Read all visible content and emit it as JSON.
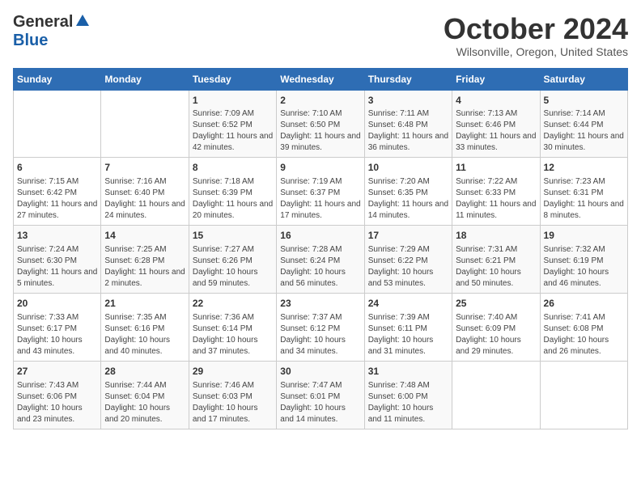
{
  "header": {
    "logo_general": "General",
    "logo_blue": "Blue",
    "title": "October 2024",
    "subtitle": "Wilsonville, Oregon, United States"
  },
  "days_of_week": [
    "Sunday",
    "Monday",
    "Tuesday",
    "Wednesday",
    "Thursday",
    "Friday",
    "Saturday"
  ],
  "weeks": [
    [
      {
        "day": "",
        "sunrise": "",
        "sunset": "",
        "daylight": ""
      },
      {
        "day": "",
        "sunrise": "",
        "sunset": "",
        "daylight": ""
      },
      {
        "day": "1",
        "sunrise": "Sunrise: 7:09 AM",
        "sunset": "Sunset: 6:52 PM",
        "daylight": "Daylight: 11 hours and 42 minutes."
      },
      {
        "day": "2",
        "sunrise": "Sunrise: 7:10 AM",
        "sunset": "Sunset: 6:50 PM",
        "daylight": "Daylight: 11 hours and 39 minutes."
      },
      {
        "day": "3",
        "sunrise": "Sunrise: 7:11 AM",
        "sunset": "Sunset: 6:48 PM",
        "daylight": "Daylight: 11 hours and 36 minutes."
      },
      {
        "day": "4",
        "sunrise": "Sunrise: 7:13 AM",
        "sunset": "Sunset: 6:46 PM",
        "daylight": "Daylight: 11 hours and 33 minutes."
      },
      {
        "day": "5",
        "sunrise": "Sunrise: 7:14 AM",
        "sunset": "Sunset: 6:44 PM",
        "daylight": "Daylight: 11 hours and 30 minutes."
      }
    ],
    [
      {
        "day": "6",
        "sunrise": "Sunrise: 7:15 AM",
        "sunset": "Sunset: 6:42 PM",
        "daylight": "Daylight: 11 hours and 27 minutes."
      },
      {
        "day": "7",
        "sunrise": "Sunrise: 7:16 AM",
        "sunset": "Sunset: 6:40 PM",
        "daylight": "Daylight: 11 hours and 24 minutes."
      },
      {
        "day": "8",
        "sunrise": "Sunrise: 7:18 AM",
        "sunset": "Sunset: 6:39 PM",
        "daylight": "Daylight: 11 hours and 20 minutes."
      },
      {
        "day": "9",
        "sunrise": "Sunrise: 7:19 AM",
        "sunset": "Sunset: 6:37 PM",
        "daylight": "Daylight: 11 hours and 17 minutes."
      },
      {
        "day": "10",
        "sunrise": "Sunrise: 7:20 AM",
        "sunset": "Sunset: 6:35 PM",
        "daylight": "Daylight: 11 hours and 14 minutes."
      },
      {
        "day": "11",
        "sunrise": "Sunrise: 7:22 AM",
        "sunset": "Sunset: 6:33 PM",
        "daylight": "Daylight: 11 hours and 11 minutes."
      },
      {
        "day": "12",
        "sunrise": "Sunrise: 7:23 AM",
        "sunset": "Sunset: 6:31 PM",
        "daylight": "Daylight: 11 hours and 8 minutes."
      }
    ],
    [
      {
        "day": "13",
        "sunrise": "Sunrise: 7:24 AM",
        "sunset": "Sunset: 6:30 PM",
        "daylight": "Daylight: 11 hours and 5 minutes."
      },
      {
        "day": "14",
        "sunrise": "Sunrise: 7:25 AM",
        "sunset": "Sunset: 6:28 PM",
        "daylight": "Daylight: 11 hours and 2 minutes."
      },
      {
        "day": "15",
        "sunrise": "Sunrise: 7:27 AM",
        "sunset": "Sunset: 6:26 PM",
        "daylight": "Daylight: 10 hours and 59 minutes."
      },
      {
        "day": "16",
        "sunrise": "Sunrise: 7:28 AM",
        "sunset": "Sunset: 6:24 PM",
        "daylight": "Daylight: 10 hours and 56 minutes."
      },
      {
        "day": "17",
        "sunrise": "Sunrise: 7:29 AM",
        "sunset": "Sunset: 6:22 PM",
        "daylight": "Daylight: 10 hours and 53 minutes."
      },
      {
        "day": "18",
        "sunrise": "Sunrise: 7:31 AM",
        "sunset": "Sunset: 6:21 PM",
        "daylight": "Daylight: 10 hours and 50 minutes."
      },
      {
        "day": "19",
        "sunrise": "Sunrise: 7:32 AM",
        "sunset": "Sunset: 6:19 PM",
        "daylight": "Daylight: 10 hours and 46 minutes."
      }
    ],
    [
      {
        "day": "20",
        "sunrise": "Sunrise: 7:33 AM",
        "sunset": "Sunset: 6:17 PM",
        "daylight": "Daylight: 10 hours and 43 minutes."
      },
      {
        "day": "21",
        "sunrise": "Sunrise: 7:35 AM",
        "sunset": "Sunset: 6:16 PM",
        "daylight": "Daylight: 10 hours and 40 minutes."
      },
      {
        "day": "22",
        "sunrise": "Sunrise: 7:36 AM",
        "sunset": "Sunset: 6:14 PM",
        "daylight": "Daylight: 10 hours and 37 minutes."
      },
      {
        "day": "23",
        "sunrise": "Sunrise: 7:37 AM",
        "sunset": "Sunset: 6:12 PM",
        "daylight": "Daylight: 10 hours and 34 minutes."
      },
      {
        "day": "24",
        "sunrise": "Sunrise: 7:39 AM",
        "sunset": "Sunset: 6:11 PM",
        "daylight": "Daylight: 10 hours and 31 minutes."
      },
      {
        "day": "25",
        "sunrise": "Sunrise: 7:40 AM",
        "sunset": "Sunset: 6:09 PM",
        "daylight": "Daylight: 10 hours and 29 minutes."
      },
      {
        "day": "26",
        "sunrise": "Sunrise: 7:41 AM",
        "sunset": "Sunset: 6:08 PM",
        "daylight": "Daylight: 10 hours and 26 minutes."
      }
    ],
    [
      {
        "day": "27",
        "sunrise": "Sunrise: 7:43 AM",
        "sunset": "Sunset: 6:06 PM",
        "daylight": "Daylight: 10 hours and 23 minutes."
      },
      {
        "day": "28",
        "sunrise": "Sunrise: 7:44 AM",
        "sunset": "Sunset: 6:04 PM",
        "daylight": "Daylight: 10 hours and 20 minutes."
      },
      {
        "day": "29",
        "sunrise": "Sunrise: 7:46 AM",
        "sunset": "Sunset: 6:03 PM",
        "daylight": "Daylight: 10 hours and 17 minutes."
      },
      {
        "day": "30",
        "sunrise": "Sunrise: 7:47 AM",
        "sunset": "Sunset: 6:01 PM",
        "daylight": "Daylight: 10 hours and 14 minutes."
      },
      {
        "day": "31",
        "sunrise": "Sunrise: 7:48 AM",
        "sunset": "Sunset: 6:00 PM",
        "daylight": "Daylight: 10 hours and 11 minutes."
      },
      {
        "day": "",
        "sunrise": "",
        "sunset": "",
        "daylight": ""
      },
      {
        "day": "",
        "sunrise": "",
        "sunset": "",
        "daylight": ""
      }
    ]
  ]
}
